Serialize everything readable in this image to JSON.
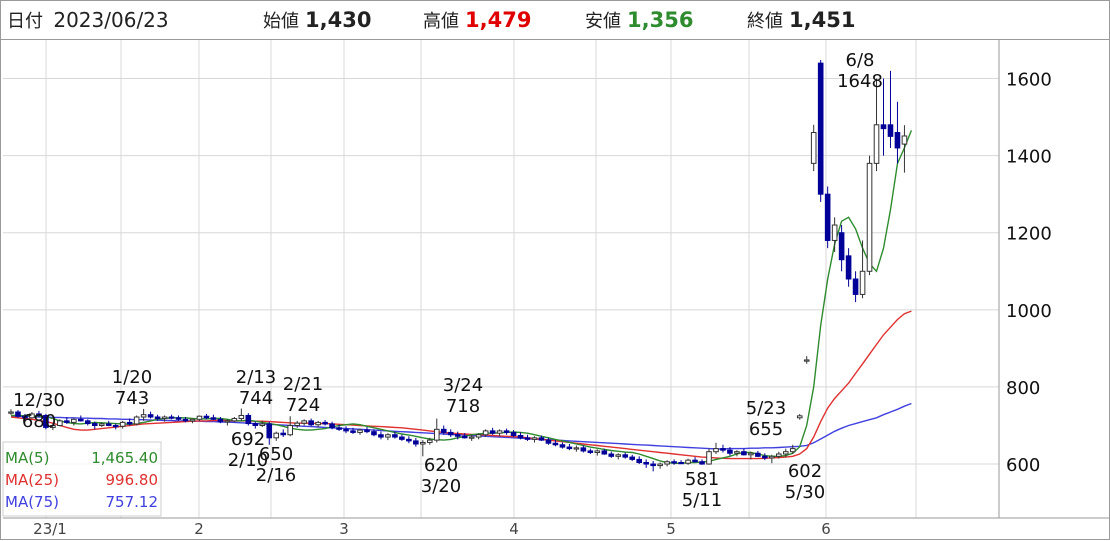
{
  "header": {
    "date_label": "日付",
    "date_value": "2023/06/23",
    "open_label": "始値",
    "open_value": "1,430",
    "high_label": "高値",
    "high_value": "1,479",
    "low_label": "安値",
    "low_value": "1,356",
    "close_label": "終値",
    "close_value": "1,451"
  },
  "colors": {
    "high_value": "#e00000",
    "low_value": "#2e8b2e",
    "ma5": "#2e8b2e",
    "ma25": "#e03030",
    "ma75": "#4040e0",
    "down_candle": "#000099",
    "grid": "#d8d8d8"
  },
  "chart_data": {
    "type": "candlestick",
    "x_ticks": [
      "23/1",
      "2",
      "3",
      "4",
      "5",
      "6"
    ],
    "y_ticks": [
      600,
      800,
      1000,
      1200,
      1400,
      1600
    ],
    "ylim": [
      460,
      1700
    ],
    "grid": true,
    "legend": [
      {
        "name": "MA(5)",
        "value": "1,465.40"
      },
      {
        "name": "MA(25)",
        "value": "996.80"
      },
      {
        "name": "MA(75)",
        "value": "757.12"
      }
    ],
    "annotations": [
      {
        "date": "12/30",
        "value": "680"
      },
      {
        "date": "1/20",
        "value": "743"
      },
      {
        "date": "2/13",
        "value": "744"
      },
      {
        "date": "2/21",
        "value": "724"
      },
      {
        "date": "2/10",
        "value": "692"
      },
      {
        "date": "2/16",
        "value": "650"
      },
      {
        "date": "3/24",
        "value": "718"
      },
      {
        "date": "3/20",
        "value": "620"
      },
      {
        "date": "5/23",
        "value": "655"
      },
      {
        "date": "5/11",
        "value": "581"
      },
      {
        "date": "5/30",
        "value": "602"
      },
      {
        "date": "6/8",
        "value": "1648"
      }
    ],
    "candles": [
      [
        732,
        742,
        728,
        735
      ],
      [
        735,
        740,
        720,
        724
      ],
      [
        724,
        730,
        715,
        720
      ],
      [
        720,
        735,
        718,
        730
      ],
      [
        730,
        738,
        722,
        726
      ],
      [
        726,
        730,
        690,
        695
      ],
      [
        695,
        706,
        688,
        700
      ],
      [
        700,
        716,
        698,
        712
      ],
      [
        712,
        722,
        704,
        708
      ],
      [
        708,
        718,
        700,
        716
      ],
      [
        716,
        726,
        710,
        712
      ],
      [
        712,
        716,
        700,
        705
      ],
      [
        705,
        710,
        690,
        700
      ],
      [
        700,
        708,
        696,
        704
      ],
      [
        704,
        712,
        698,
        700
      ],
      [
        700,
        705,
        690,
        698
      ],
      [
        698,
        712,
        692,
        708
      ],
      [
        708,
        718,
        700,
        704
      ],
      [
        704,
        726,
        700,
        722
      ],
      [
        722,
        743,
        712,
        728
      ],
      [
        728,
        736,
        718,
        722
      ],
      [
        722,
        728,
        712,
        718
      ],
      [
        718,
        726,
        710,
        722
      ],
      [
        722,
        728,
        716,
        720
      ],
      [
        720,
        726,
        712,
        716
      ],
      [
        716,
        722,
        708,
        712
      ],
      [
        712,
        718,
        706,
        716
      ],
      [
        716,
        726,
        712,
        724
      ],
      [
        724,
        730,
        716,
        720
      ],
      [
        720,
        728,
        714,
        716
      ],
      [
        716,
        722,
        706,
        710
      ],
      [
        710,
        716,
        700,
        712
      ],
      [
        712,
        722,
        708,
        718
      ],
      [
        718,
        744,
        712,
        726
      ],
      [
        726,
        732,
        700,
        705
      ],
      [
        705,
        710,
        692,
        700
      ],
      [
        700,
        712,
        696,
        704
      ],
      [
        704,
        710,
        650,
        668
      ],
      [
        668,
        684,
        660,
        680
      ],
      [
        680,
        690,
        670,
        676
      ],
      [
        676,
        724,
        672,
        700
      ],
      [
        700,
        712,
        694,
        706
      ],
      [
        706,
        716,
        700,
        712
      ],
      [
        712,
        718,
        698,
        702
      ],
      [
        702,
        712,
        696,
        708
      ],
      [
        708,
        714,
        700,
        704
      ],
      [
        704,
        710,
        690,
        694
      ],
      [
        694,
        702,
        686,
        690
      ],
      [
        690,
        698,
        680,
        686
      ],
      [
        686,
        694,
        678,
        682
      ],
      [
        682,
        692,
        676,
        688
      ],
      [
        688,
        696,
        680,
        684
      ],
      [
        684,
        690,
        672,
        676
      ],
      [
        676,
        684,
        664,
        670
      ],
      [
        670,
        680,
        662,
        676
      ],
      [
        676,
        684,
        666,
        670
      ],
      [
        670,
        676,
        660,
        664
      ],
      [
        664,
        672,
        654,
        660
      ],
      [
        660,
        668,
        645,
        652
      ],
      [
        652,
        662,
        620,
        656
      ],
      [
        656,
        668,
        650,
        662
      ],
      [
        662,
        718,
        656,
        690
      ],
      [
        690,
        700,
        676,
        682
      ],
      [
        682,
        690,
        670,
        676
      ],
      [
        676,
        684,
        664,
        672
      ],
      [
        672,
        680,
        666,
        668
      ],
      [
        668,
        676,
        660,
        670
      ],
      [
        670,
        680,
        664,
        676
      ],
      [
        676,
        690,
        670,
        686
      ],
      [
        686,
        694,
        676,
        680
      ],
      [
        680,
        690,
        672,
        686
      ],
      [
        686,
        692,
        676,
        682
      ],
      [
        682,
        688,
        670,
        674
      ],
      [
        674,
        682,
        664,
        668
      ],
      [
        668,
        676,
        660,
        664
      ],
      [
        664,
        672,
        656,
        668
      ],
      [
        668,
        674,
        660,
        662
      ],
      [
        662,
        668,
        650,
        654
      ],
      [
        654,
        662,
        646,
        650
      ],
      [
        650,
        656,
        640,
        644
      ],
      [
        644,
        652,
        636,
        640
      ],
      [
        640,
        648,
        632,
        642
      ],
      [
        642,
        648,
        630,
        634
      ],
      [
        634,
        640,
        626,
        630
      ],
      [
        630,
        638,
        622,
        634
      ],
      [
        634,
        640,
        624,
        626
      ],
      [
        626,
        632,
        616,
        620
      ],
      [
        620,
        628,
        612,
        624
      ],
      [
        624,
        630,
        614,
        618
      ],
      [
        618,
        624,
        608,
        612
      ],
      [
        612,
        620,
        600,
        604
      ],
      [
        604,
        612,
        590,
        600
      ],
      [
        600,
        608,
        581,
        596
      ],
      [
        596,
        604,
        588,
        600
      ],
      [
        600,
        610,
        594,
        606
      ],
      [
        606,
        612,
        598,
        604
      ],
      [
        604,
        610,
        600,
        602
      ],
      [
        602,
        614,
        598,
        610
      ],
      [
        610,
        618,
        604,
        606
      ],
      [
        606,
        612,
        598,
        600
      ],
      [
        600,
        640,
        598,
        632
      ],
      [
        632,
        655,
        626,
        640
      ],
      [
        640,
        650,
        630,
        636
      ],
      [
        636,
        644,
        622,
        628
      ],
      [
        628,
        636,
        620,
        632
      ],
      [
        632,
        640,
        622,
        624
      ],
      [
        624,
        632,
        612,
        628
      ],
      [
        628,
        634,
        618,
        620
      ],
      [
        620,
        628,
        610,
        616
      ],
      [
        616,
        624,
        602,
        620
      ],
      [
        620,
        632,
        614,
        626
      ],
      [
        626,
        640,
        618,
        632
      ],
      [
        632,
        650,
        626,
        640
      ],
      [
        720,
        730,
        715,
        725
      ],
      [
        870,
        880,
        860,
        870
      ],
      [
        1380,
        1480,
        1360,
        1460
      ],
      [
        1640,
        1648,
        1280,
        1300
      ],
      [
        1300,
        1320,
        1160,
        1180
      ],
      [
        1180,
        1240,
        1150,
        1220
      ],
      [
        1200,
        1220,
        1100,
        1130
      ],
      [
        1140,
        1160,
        1060,
        1080
      ],
      [
        1080,
        1100,
        1020,
        1040
      ],
      [
        1040,
        1180,
        1030,
        1100
      ],
      [
        1100,
        1400,
        1090,
        1380
      ],
      [
        1380,
        1600,
        1360,
        1480
      ],
      [
        1480,
        1600,
        1400,
        1470
      ],
      [
        1480,
        1620,
        1420,
        1450
      ],
      [
        1460,
        1540,
        1380,
        1420
      ],
      [
        1430,
        1479,
        1356,
        1451
      ]
    ],
    "ma5": [
      726,
      726,
      725,
      725,
      724,
      722,
      718,
      712,
      708,
      705,
      704,
      706,
      708,
      707,
      706,
      705,
      704,
      703,
      705,
      708,
      712,
      716,
      718,
      720,
      720,
      720,
      718,
      717,
      717,
      718,
      718,
      716,
      713,
      712,
      714,
      711,
      708,
      705,
      702,
      698,
      693,
      690,
      688,
      688,
      690,
      692,
      696,
      700,
      702,
      704,
      702,
      698,
      694,
      690,
      686,
      682,
      678,
      675,
      672,
      668,
      665,
      663,
      662,
      664,
      668,
      672,
      676,
      678,
      680,
      680,
      681,
      682,
      683,
      682,
      680,
      676,
      672,
      668,
      664,
      660,
      656,
      652,
      648,
      644,
      641,
      638,
      635,
      633,
      631,
      630,
      626,
      620,
      614,
      608,
      604,
      602,
      602,
      604,
      604,
      605,
      607,
      612,
      616,
      620,
      626,
      630,
      630,
      626,
      622,
      620,
      620,
      622,
      628,
      645,
      700,
      800,
      960,
      1080,
      1170,
      1230,
      1240,
      1210,
      1160,
      1120,
      1100,
      1160,
      1260,
      1380,
      1420,
      1465.4
    ],
    "ma25": [
      722,
      720,
      718,
      716,
      713,
      710,
      706,
      700,
      695,
      690,
      688,
      688,
      690,
      692,
      694,
      696,
      698,
      700,
      702,
      704,
      705,
      706,
      707,
      708,
      709,
      710,
      711,
      712,
      712,
      713,
      713,
      713,
      712,
      712,
      712,
      711,
      711,
      710,
      709,
      708,
      707,
      706,
      706,
      706,
      705,
      705,
      704,
      703,
      702,
      701,
      700,
      699,
      698,
      697,
      696,
      695,
      694,
      692,
      690,
      688,
      686,
      684,
      682,
      680,
      679,
      678,
      677,
      676,
      675,
      674,
      673,
      672,
      671,
      670,
      668,
      666,
      664,
      662,
      660,
      658,
      656,
      654,
      652,
      650,
      648,
      646,
      644,
      642,
      640,
      638,
      636,
      634,
      632,
      630,
      628,
      626,
      624,
      622,
      620,
      618,
      617,
      616,
      615,
      614,
      614,
      614,
      614,
      614,
      615,
      616,
      617,
      618,
      620,
      626,
      640,
      670,
      710,
      745,
      770,
      790,
      810,
      835,
      860,
      885,
      910,
      935,
      955,
      975,
      990,
      996.8
    ],
    "ma75": [
      724,
      724,
      723,
      723,
      722,
      722,
      721,
      721,
      720,
      720,
      719,
      719,
      718,
      718,
      717,
      717,
      716,
      716,
      715,
      715,
      714,
      714,
      713,
      713,
      712,
      712,
      711,
      711,
      710,
      710,
      709,
      709,
      708,
      707,
      706,
      705,
      704,
      703,
      702,
      701,
      700,
      699,
      698,
      697,
      696,
      695,
      694,
      693,
      692,
      691,
      690,
      689,
      688,
      687,
      686,
      685,
      684,
      683,
      682,
      681,
      680,
      679,
      678,
      677,
      676,
      675,
      674,
      673,
      672,
      671,
      670,
      669,
      668,
      667,
      666,
      665,
      664,
      663,
      662,
      661,
      660,
      659,
      658,
      657,
      656,
      655,
      654,
      653,
      652,
      651,
      650,
      649,
      648,
      647,
      646,
      645,
      644,
      643,
      642,
      641,
      640,
      639,
      639,
      640,
      640,
      640,
      641,
      641,
      642,
      642,
      643,
      644,
      645,
      646,
      648,
      655,
      665,
      675,
      685,
      693,
      700,
      705,
      710,
      715,
      720,
      728,
      735,
      742,
      750,
      757.12
    ]
  }
}
